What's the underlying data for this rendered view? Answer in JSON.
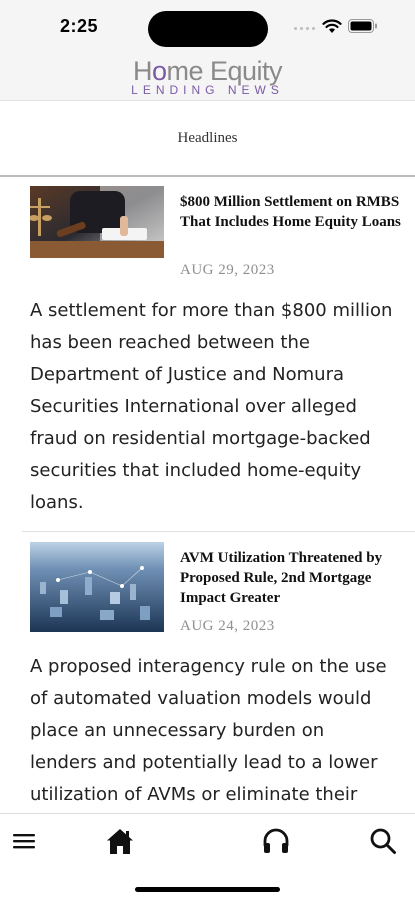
{
  "status_bar": {
    "time": "2:25"
  },
  "header": {
    "logo_main_before": "H",
    "logo_main_o": "o",
    "logo_main_after": "me Equity",
    "logo_sub": "LENDING NEWS"
  },
  "section": {
    "title": "Headlines"
  },
  "articles": [
    {
      "headline": "$800 Million Settlement on RMBS That Includes Home Equity Loans",
      "date": "AUG 29, 2023",
      "summary": "A settlement for more than $800 million has been reached between the Department of Justice and Nomura Securities International over alleged fraud on residential mortgage-backed securities that included home-equity loans.",
      "image": "gavel-scales-photo"
    },
    {
      "headline": "AVM Utilization Threatened by Proposed Rule, 2nd Mortgage Impact Greater",
      "date": "AUG 24, 2023",
      "summary": "A proposed interagency rule on the use of automated valuation models would place an unnecessary burden on lenders and potentially lead to a lower utilization of AVMs or eliminate their",
      "image": "city-aerial-photo"
    }
  ],
  "tabbar": {
    "items": [
      {
        "name": "menu",
        "icon": "hamburger-icon"
      },
      {
        "name": "home",
        "icon": "home-icon"
      },
      {
        "name": "podcast",
        "icon": "headphones-icon"
      },
      {
        "name": "search",
        "icon": "search-icon"
      }
    ]
  },
  "colors": {
    "accent": "#7a5aa6",
    "logo_gray": "#8a8a8a",
    "date_gray": "#8f8f8f"
  }
}
